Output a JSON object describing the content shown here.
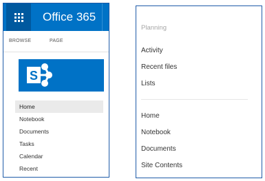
{
  "suite": {
    "title": "Office 365"
  },
  "ribbon": {
    "tabs": [
      "BROWSE",
      "PAGE"
    ]
  },
  "left_nav": {
    "items": [
      "Home",
      "Notebook",
      "Documents",
      "Tasks",
      "Calendar",
      "Recent"
    ],
    "selected": "Home"
  },
  "right_panel": {
    "section_header": "Planning",
    "group1": [
      "Activity",
      "Recent files",
      "Lists"
    ],
    "group2": [
      "Home",
      "Notebook",
      "Documents",
      "Site Contents"
    ]
  },
  "icons": {
    "app_launcher": "waffle-icon",
    "site_logo": "sharepoint-logo-icon"
  },
  "colors": {
    "suite_bar": "#0072c6",
    "waffle_bg": "#00599f",
    "frame_border": "#1d5aa8",
    "selected_bg": "#eaeaea"
  }
}
